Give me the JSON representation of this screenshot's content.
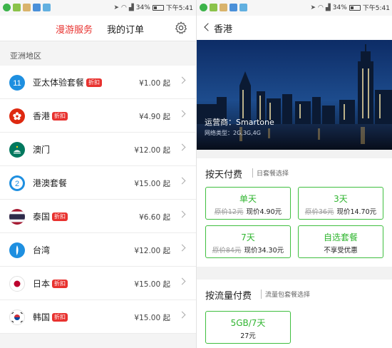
{
  "status_bar": {
    "battery": "34%",
    "time": "下午5:41"
  },
  "left": {
    "tabs": [
      "漫游服务",
      "我的订单"
    ],
    "section_title": "亚洲地区",
    "badge_label": "折扣",
    "regions": [
      {
        "name": "亚太体验套餐",
        "price": "¥1.00 起",
        "discount": true,
        "icon": "number-11-icon"
      },
      {
        "name": "香港",
        "price": "¥4.90 起",
        "discount": true,
        "icon": "hong-kong-flag-icon"
      },
      {
        "name": "澳门",
        "price": "¥12.00 起",
        "discount": false,
        "icon": "macau-flag-icon"
      },
      {
        "name": "港澳套餐",
        "price": "¥15.00 起",
        "discount": false,
        "icon": "number-2-icon"
      },
      {
        "name": "泰国",
        "price": "¥6.60 起",
        "discount": true,
        "icon": "thailand-flag-icon"
      },
      {
        "name": "台湾",
        "price": "¥12.00 起",
        "discount": false,
        "icon": "taiwan-icon"
      },
      {
        "name": "日本",
        "price": "¥15.00 起",
        "discount": true,
        "icon": "japan-flag-icon"
      },
      {
        "name": "韩国",
        "price": "¥15.00 起",
        "discount": true,
        "icon": "korea-flag-icon"
      }
    ]
  },
  "right": {
    "title": "香港",
    "operator": "运营商：Smartone",
    "network": "网络类型：2G,3G,4G",
    "daily": {
      "title": "按天付费",
      "subtitle": "日套餐选择",
      "options": [
        {
          "title": "单天",
          "orig": "原价12元",
          "now": "现价4.90元"
        },
        {
          "title": "3天",
          "orig": "原价36元",
          "now": "现价14.70元"
        },
        {
          "title": "7天",
          "orig": "原价84元",
          "now": "现价34.30元"
        },
        {
          "title": "自选套餐",
          "orig": "",
          "now": "不享受优惠"
        }
      ]
    },
    "flow": {
      "title": "按流量付费",
      "subtitle": "流量包套餐选择",
      "options": [
        {
          "title": "5GB/7天",
          "now": "27元"
        }
      ]
    }
  },
  "colors": {
    "accent_red": "#e8322f",
    "option_green": "#3fbf3f"
  }
}
